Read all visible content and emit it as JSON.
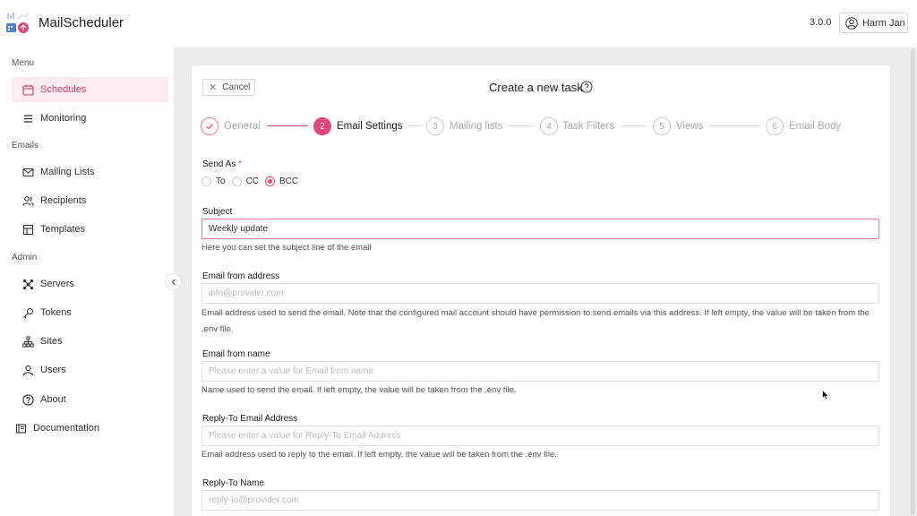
{
  "header": {
    "app_title": "MailScheduler",
    "version": "3.0.0",
    "user_name": "Harm Jan"
  },
  "sidebar": {
    "sections": [
      {
        "label": "Menu",
        "items": [
          {
            "label": "Schedules",
            "icon": "calendar-icon",
            "active": true
          },
          {
            "label": "Monitoring",
            "icon": "list-icon"
          }
        ]
      },
      {
        "label": "Emails",
        "items": [
          {
            "label": "Mailing Lists",
            "icon": "mail-icon"
          },
          {
            "label": "Recipients",
            "icon": "users-icon"
          },
          {
            "label": "Templates",
            "icon": "template-icon"
          }
        ]
      },
      {
        "label": "Admin",
        "items": [
          {
            "label": "Servers",
            "icon": "network-icon"
          },
          {
            "label": "Tokens",
            "icon": "key-icon"
          },
          {
            "label": "Sites",
            "icon": "sitemap-icon"
          },
          {
            "label": "Users",
            "icon": "user-icon"
          },
          {
            "label": "About",
            "icon": "question-icon"
          }
        ]
      }
    ],
    "documentation": {
      "label": "Documentation",
      "icon": "book-icon"
    }
  },
  "card": {
    "cancel_label": "Cancel",
    "title": "Create a new task"
  },
  "steps": [
    {
      "number": "1",
      "label": "General",
      "state": "done"
    },
    {
      "number": "2",
      "label": "Email Settings",
      "state": "current"
    },
    {
      "number": "3",
      "label": "Mailing lists",
      "state": "pending"
    },
    {
      "number": "4",
      "label": "Task Filters",
      "state": "pending"
    },
    {
      "number": "5",
      "label": "Views",
      "state": "pending"
    },
    {
      "number": "6",
      "label": "Email Body",
      "state": "pending"
    }
  ],
  "form": {
    "send_as": {
      "label": "Send As",
      "required_mark": "*",
      "options": [
        "To",
        "CC",
        "BCC"
      ],
      "selected": "BCC"
    },
    "subject": {
      "label": "Subject",
      "value": "Weekly update",
      "help": "Here you can set the subject line of the email"
    },
    "email_from_address": {
      "label": "Email from address",
      "placeholder": "info@provider.com",
      "help": "Email address used to send the email. Note that the configured mail account should have permission to send emails via this address. If left empty, the value will be taken from the .env file."
    },
    "email_from_name": {
      "label": "Email from name",
      "placeholder": "Please enter a value for Email from name",
      "help": "Name used to send the email. If left empty, the value will be taken from the .env file."
    },
    "reply_to_address": {
      "label": "Reply-To Email Address",
      "placeholder": "Please enter a value for Reply-To Email Address",
      "help": "Email address used to reply to the email. If left empty, the value will be taken from the .env file."
    },
    "reply_to_name": {
      "label": "Reply-To Name",
      "placeholder": "reply-to@provider.com"
    }
  },
  "colors": {
    "accent": "#e0457e",
    "active_bg": "#fdecef",
    "main_bg": "#ececee"
  }
}
